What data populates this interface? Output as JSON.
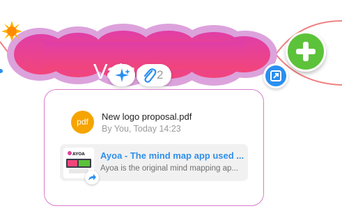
{
  "node": {
    "title": "Values",
    "emoji_icon": "sun-icon",
    "fill_colors": [
      "#e640a8",
      "#f04078"
    ],
    "outline_color": "#d98ed6"
  },
  "toolbar": {
    "magic_icon": "sparkle-icon",
    "attach_icon": "paperclip-icon",
    "attachment_count": "2"
  },
  "actions": {
    "add_icon": "plus-icon",
    "add_color": "#5cc23a",
    "focus_icon": "focus-square-icon",
    "focus_color": "#2b8ff0"
  },
  "attachments": {
    "file": {
      "type_label": "pdf",
      "name": "New logo proposal.pdf",
      "meta": "By You, Today 14:23"
    },
    "link": {
      "thumb_brand": "AYOA",
      "title": "Ayoa - The mind map app used ...",
      "description": "Ayoa is the original mind mapping ap...",
      "share_icon": "share-arrow-icon"
    }
  }
}
